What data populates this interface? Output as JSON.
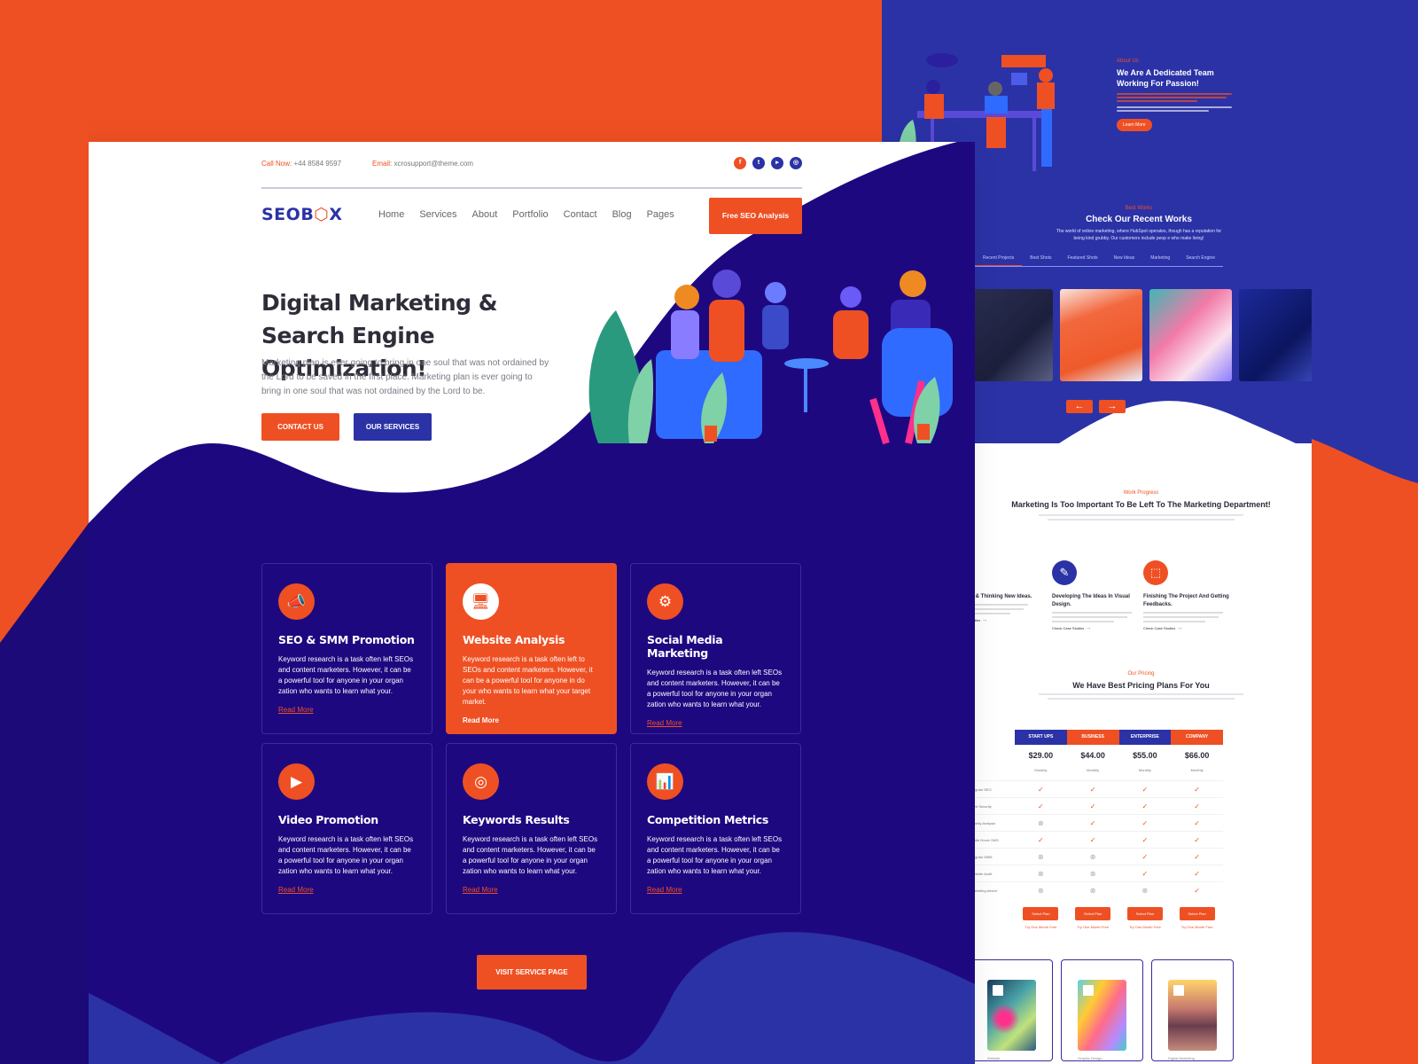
{
  "colors": {
    "accent": "#ef5023",
    "primary": "#2b32a6",
    "dark": "#1e0880"
  },
  "topbar": {
    "call_label": "Call Now:",
    "call_value": "+44 8584 9597",
    "email_label": "Email:",
    "email_value": "xcrosupport@theme.com",
    "socials": [
      {
        "icon": "facebook-icon",
        "glyph": "f"
      },
      {
        "icon": "twitter-icon",
        "glyph": "t"
      },
      {
        "icon": "youtube-icon",
        "glyph": "▸"
      },
      {
        "icon": "instagram-icon",
        "glyph": "◎"
      }
    ]
  },
  "header": {
    "logo_pre": "SEOB",
    "logo_box": "⬡",
    "logo_post": "X",
    "nav": [
      "Home",
      "Services",
      "About",
      "Portfolio",
      "Contact",
      "Blog",
      "Pages"
    ],
    "cta": "Free SEO Analysis"
  },
  "hero": {
    "title": "Digital Marketing & Search Engine Optimization!",
    "description": "Marketing plan is ever going to bring in one soul that was not ordained by the Lord to be saved in the first place. Marketing plan is ever going to bring in one soul that was not ordained by the Lord to be.",
    "contact_btn": "CONTACT US",
    "services_btn": "OUR SERVICES"
  },
  "services": {
    "cards": [
      {
        "title": "SEO & SMM Promotion",
        "icon": "megaphone-icon",
        "glyph": "📣",
        "text": "Keyword research is a task often left SEOs and content marketers. However, it can be a powerful tool for anyone in your organ zation who wants to learn what your.",
        "link": "Read More",
        "active": false
      },
      {
        "title": "Website Analysis",
        "icon": "monitor-analysis-icon",
        "glyph": "🖥",
        "text": "Keyword research is a task often left to SEOs and content marketers. However, it can be a powerful tool for anyone in do your who wants to learn what your target market.",
        "link": "Read More",
        "active": true
      },
      {
        "title": "Social Media Marketing",
        "icon": "social-network-icon",
        "glyph": "⚙",
        "text": "Keyword research is a task often left SEOs and content marketers. However, it can be a powerful tool for anyone in your organ zation who wants to learn what your.",
        "link": "Read More",
        "active": false
      },
      {
        "title": "Video Promotion",
        "icon": "video-icon",
        "glyph": "▶",
        "text": "Keyword research is a task often left SEOs and content marketers. However, it can be a powerful tool for anyone in your organ zation who wants to learn what your.",
        "link": "Read More",
        "active": false
      },
      {
        "title": "Keywords Results",
        "icon": "keyword-target-icon",
        "glyph": "◎",
        "text": "Keyword research is a task often left SEOs and content marketers. However, it can be a powerful tool for anyone in your organ zation who wants to learn what your.",
        "link": "Read More",
        "active": false
      },
      {
        "title": "Competition Metrics",
        "icon": "bar-chart-icon",
        "glyph": "📊",
        "text": "Keyword research is a task often left SEOs and content marketers. However, it can be a powerful tool for anyone in your organ zation who wants to learn what your.",
        "link": "Read More",
        "active": false
      }
    ],
    "visit_btn": "VISIT SERVICE PAGE"
  },
  "about": {
    "eyebrow": "About Us",
    "title": "We Are A Dedicated Team Working For Passion!",
    "button": "Learn More"
  },
  "works": {
    "eyebrow": "Best Works",
    "title": "Check Our Recent Works",
    "description": "The world of online marketing, where HubSpot operates, though has a reputation for being kind grubby. Our customers include peop e who make living!",
    "tabs": [
      "Recent Projects",
      "Best Shots",
      "Featured Shots",
      "New Ideas",
      "Marketing",
      "Search Engine"
    ],
    "prev": "←",
    "next": "→"
  },
  "progress": {
    "eyebrow": "Work Progress",
    "title": "Marketing Is Too Important To Be Left To The Marketing Department!",
    "steps": [
      {
        "title": "Searching & Thinking New Ideas.",
        "icon": "search-idea-icon",
        "glyph": "⌕",
        "link": "Check Case Studies"
      },
      {
        "title": "Developing The Ideas In Visual Design.",
        "icon": "design-board-icon",
        "glyph": "✎",
        "link": "Check Case Studies"
      },
      {
        "title": "Finishing The Project And Getting Feedbacks.",
        "icon": "gift-box-icon",
        "glyph": "⬚",
        "link": "Check Case Studies"
      }
    ]
  },
  "pricing": {
    "eyebrow": "Our Pricing",
    "title": "We Have Best Pricing Plans For You",
    "plans": [
      {
        "name": "START UPS",
        "price": "$29.00",
        "period": "Monthly",
        "color": "#2b32a6"
      },
      {
        "name": "BUSINESS",
        "price": "$44.00",
        "period": "Monthly",
        "color": "#ef5023"
      },
      {
        "name": "ENTERPRISE",
        "price": "$55.00",
        "period": "Monthly",
        "color": "#2b32a6"
      },
      {
        "name": "COMPANY",
        "price": "$66.00",
        "period": "Monthly",
        "color": "#ef5023"
      }
    ],
    "features": [
      {
        "label": "Regular SEO",
        "values": [
          true,
          true,
          true,
          true
        ]
      },
      {
        "label": "Web Security",
        "values": [
          true,
          true,
          true,
          true
        ]
      },
      {
        "label": "Priority Analysis",
        "values": [
          false,
          true,
          true,
          true
        ]
      },
      {
        "label": "White Hover SMS",
        "values": [
          true,
          true,
          true,
          true
        ]
      },
      {
        "label": "Regular SMM",
        "values": [
          false,
          false,
          true,
          true
        ]
      },
      {
        "label": "Website Audit",
        "values": [
          false,
          false,
          true,
          true
        ]
      },
      {
        "label": "Marketing Advice",
        "values": [
          false,
          false,
          false,
          true
        ]
      }
    ],
    "select_btn": "Select Plan",
    "trial": "Try One Month Free"
  },
  "blog": {
    "cards": [
      {
        "category": "Website"
      },
      {
        "category": "Graphic Design"
      },
      {
        "category": "Digital Marketing"
      }
    ]
  }
}
